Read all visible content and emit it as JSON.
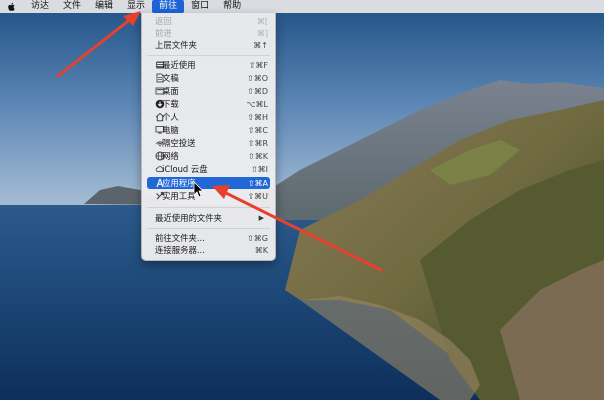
{
  "menubar": {
    "apple": "apple-logo-icon",
    "items": [
      "访达",
      "文件",
      "编辑",
      "显示",
      "前往",
      "窗口",
      "帮助"
    ],
    "active_index": 4,
    "active_color": "#1e63d6"
  },
  "go_menu": {
    "back": {
      "label": "返回",
      "shortcut": "⌘["
    },
    "forward": {
      "label": "前进",
      "shortcut": "⌘]"
    },
    "enclosing": {
      "label": "上层文件夹",
      "shortcut": "⌘↑"
    },
    "recents": {
      "label": "最近使用",
      "shortcut": "⇧⌘F",
      "icon": "recents-icon"
    },
    "documents": {
      "label": "文稿",
      "shortcut": "⇧⌘O",
      "icon": "documents-icon"
    },
    "desktop": {
      "label": "桌面",
      "shortcut": "⇧⌘D",
      "icon": "desktop-icon"
    },
    "downloads": {
      "label": "下载",
      "shortcut": "⌥⌘L",
      "icon": "downloads-icon"
    },
    "home": {
      "label": "个人",
      "shortcut": "⇧⌘H",
      "icon": "home-icon"
    },
    "computer": {
      "label": "电脑",
      "shortcut": "⇧⌘C",
      "icon": "computer-icon"
    },
    "airdrop": {
      "label": "隔空投送",
      "shortcut": "⇧⌘R",
      "icon": "airdrop-icon"
    },
    "network": {
      "label": "网络",
      "shortcut": "⇧⌘K",
      "icon": "network-icon"
    },
    "icloud": {
      "label": "iCloud 云盘",
      "shortcut": "⇧⌘I",
      "icon": "icloud-icon"
    },
    "applications": {
      "label": "应用程序",
      "shortcut": "⇧⌘A",
      "icon": "applications-icon",
      "highlighted": true
    },
    "utilities": {
      "label": "实用工具",
      "shortcut": "⇧⌘U",
      "icon": "utilities-icon"
    },
    "recent_folders": {
      "label": "最近使用的文件夹",
      "submenu_icon": "chevron-right-icon"
    },
    "goto_folder": {
      "label": "前往文件夹...",
      "shortcut": "⇧⌘G"
    },
    "connect_server": {
      "label": "连接服务器...",
      "shortcut": "⌘K"
    }
  },
  "colors": {
    "highlight": "#2167d6",
    "annotation_arrow": "#e8402f"
  }
}
